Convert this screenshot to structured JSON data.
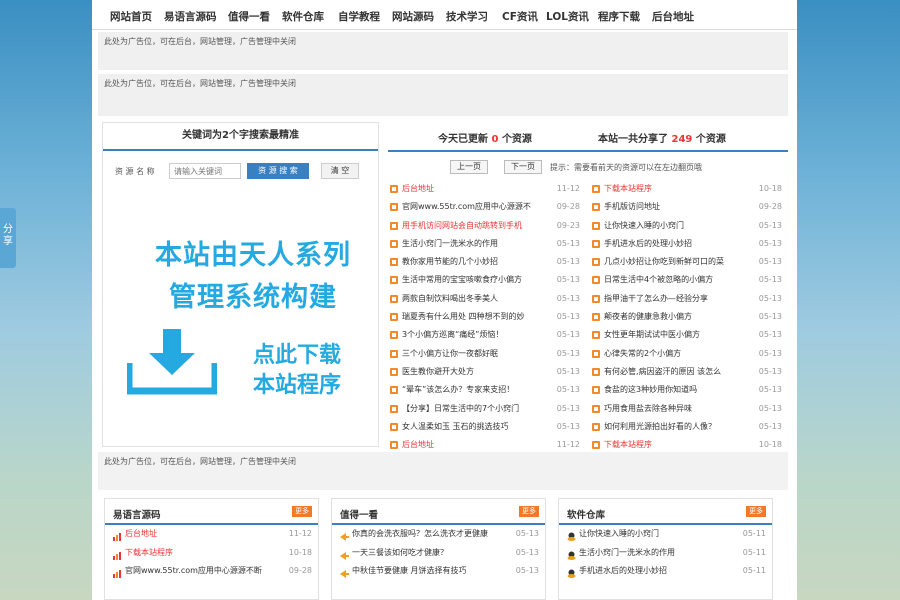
{
  "nav": [
    "网站首页",
    "易语言源码",
    "值得一看",
    "软件仓库",
    "自学教程",
    "网站源码",
    "技术学习",
    "CF资讯",
    "LOL资讯",
    "程序下载",
    "后台地址"
  ],
  "ads": {
    "ad1": "此处为广告位，可在后台，网站管理，广告管理中关闭",
    "ad2": "此处为广告位，可在后台，网站管理，广告管理中关闭",
    "ad3": "此处为广告位，可在后台，网站管理，广告管理中关闭"
  },
  "search": {
    "title": "关键词为2个字搜索最精准",
    "label": "资 源 名 称",
    "placeholder": "请输入关键词",
    "submit": "资 源 搜 索",
    "clear": "清 空"
  },
  "promo": {
    "line1": "本站由天人系列",
    "line2": "管理系统构建",
    "dl1": "点此下载",
    "dl2": "本站程序"
  },
  "stats": {
    "today_pre": "今天已更新",
    "today_num": "0",
    "today_suf": "个资源",
    "total_pre": "本站一共分享了",
    "total_num": "249",
    "total_suf": "个资源"
  },
  "pager": {
    "prev": "上一页",
    "next": "下一页",
    "tip": "提示：需要看前天的资源可以在左边翻页哦"
  },
  "list_left": [
    {
      "t": "后台地址",
      "d": "11-12",
      "red": true
    },
    {
      "t": "官网www.55tr.com应用中心源源不",
      "d": "09-28",
      "red": false
    },
    {
      "t": "用手机访问网站会自动跳转到手机",
      "d": "09-23",
      "red": true
    },
    {
      "t": "生活小窍门一洗米水的作用",
      "d": "05-13",
      "red": false
    },
    {
      "t": "教你家用节能的几个小妙招",
      "d": "05-13",
      "red": false
    },
    {
      "t": "生活中常用的宝宝咳嗽食疗小偏方",
      "d": "05-13",
      "red": false
    },
    {
      "t": "两款自制饮料喝出冬季美人",
      "d": "05-13",
      "red": false
    },
    {
      "t": "瑞夏秀有什么用处 四种想不到的妙",
      "d": "05-13",
      "red": false
    },
    {
      "t": "3个小偏方巡离“痛经”烦恼！",
      "d": "05-13",
      "red": false
    },
    {
      "t": "三个小偏方让你一夜都好眠",
      "d": "05-13",
      "red": false
    },
    {
      "t": "医生教你避开大处方",
      "d": "05-13",
      "red": false
    },
    {
      "t": "“晕车”该怎么办？专家来支招！",
      "d": "05-13",
      "red": false
    },
    {
      "t": "【分享】日常生活中的7个小窍门",
      "d": "05-13",
      "red": false
    },
    {
      "t": "女人温柔如玉 玉石的挑选技巧",
      "d": "05-13",
      "red": false
    },
    {
      "t": "后台地址",
      "d": "11-12",
      "red": true
    }
  ],
  "list_right": [
    {
      "t": "下载本站程序",
      "d": "10-18",
      "red": true
    },
    {
      "t": "手机版访问地址",
      "d": "09-28",
      "red": false
    },
    {
      "t": "让你快速入睡的小窍门",
      "d": "05-13",
      "red": false
    },
    {
      "t": "手机进水后的处理小妙招",
      "d": "05-13",
      "red": false
    },
    {
      "t": "几点小妙招让你吃到新鲜可口的菜",
      "d": "05-13",
      "red": false
    },
    {
      "t": "日常生活中4个被忽略的小偏方",
      "d": "05-13",
      "red": false
    },
    {
      "t": "指甲油干了怎么办—经验分享",
      "d": "05-13",
      "red": false
    },
    {
      "t": "颠夜者的健康急救小偏方",
      "d": "05-13",
      "red": false
    },
    {
      "t": "女性更年期试试中医小偏方",
      "d": "05-13",
      "red": false
    },
    {
      "t": "心律失常的2个小偏方",
      "d": "05-13",
      "red": false
    },
    {
      "t": "有何必管,病因盗汗的原因 该怎么",
      "d": "05-13",
      "red": false
    },
    {
      "t": "食盐的这3种妙用你知道吗",
      "d": "05-13",
      "red": false
    },
    {
      "t": "巧用食用盐去除各种异味",
      "d": "05-13",
      "red": false
    },
    {
      "t": "如何利用光源拍出好看的人像？",
      "d": "05-13",
      "red": false
    },
    {
      "t": "下载本站程序",
      "d": "10-18",
      "red": true
    }
  ],
  "boxes": [
    {
      "title": "易语言源码",
      "more": "更多",
      "items": [
        {
          "t": "后台地址",
          "d": "11-12",
          "red": true
        },
        {
          "t": "下载本站程序",
          "d": "10-18",
          "red": true
        },
        {
          "t": "官网www.55tr.com应用中心源源不断",
          "d": "09-28",
          "red": false
        }
      ]
    },
    {
      "title": "值得一看",
      "more": "更多",
      "items": [
        {
          "t": "你真的会洗衣服吗？怎么洗衣才更健康",
          "d": "05-13",
          "red": false
        },
        {
          "t": "一天三餐该如何吃才健康？",
          "d": "05-13",
          "red": false
        },
        {
          "t": "中秋佳节要健康 月饼选择有技巧",
          "d": "05-13",
          "red": false
        }
      ]
    },
    {
      "title": "软件仓库",
      "more": "更多",
      "items": [
        {
          "t": "让你快速入睡的小窍门",
          "d": "05-11",
          "red": false
        },
        {
          "t": "生活小窍门一洗米水的作用",
          "d": "05-11",
          "red": false
        },
        {
          "t": "手机进水后的处理小妙招",
          "d": "05-11",
          "red": false
        }
      ]
    }
  ],
  "share": "分享",
  "colors": {
    "accent": "#3a7fc0",
    "red": "#e33333",
    "orange": "#f08a2a",
    "promo": "#25a9e1"
  }
}
